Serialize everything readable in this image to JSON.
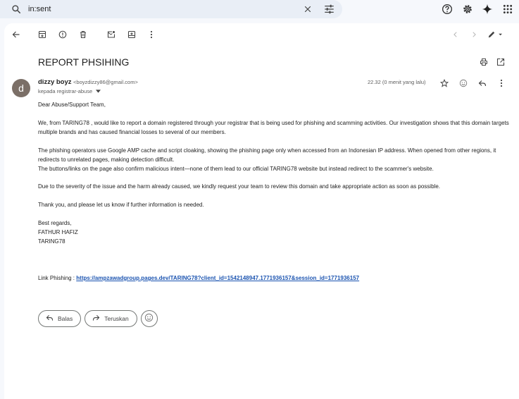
{
  "search": {
    "query": "in:sent"
  },
  "email": {
    "subject": "REPORT PHSIHING",
    "sender_initial": "d",
    "sender_name": "dizzy boyz",
    "sender_email": "<boyzdizzy86@gmail.com>",
    "recipient": "kepada registrar-abuse",
    "timestamp": "22.32 (0 menit yang lalu)",
    "greeting": "Dear Abuse/Support Team,",
    "para1": "We, from TARING78 , would like to report a domain registered through your registrar that is being used for phishing and scamming activities. Our investigation shows that this domain targets multiple brands and has caused financial losses to several of our members.",
    "para2a": "The phishing operators use Google AMP cache and script cloaking, showing the phishing page only when accessed from an Indonesian IP address. When opened from other regions, it redirects to unrelated pages, making detection difficult.",
    "para2b": "The buttons/links on the page also confirm malicious intent—none of them lead to our official TARING78  website but instead redirect to the scammer's website.",
    "para3": "Due to the severity of the issue and the harm already caused, we kindly request your team to review this domain and take appropriate action as soon as possible.",
    "para4": "Thank you, and please let us know if further information is needed.",
    "signoff": "Best regards,",
    "sig_name": "FATHUR HAFIZ",
    "sig_org": "TARING78",
    "link_label": "Link Phishing : ",
    "link_url": "https://ampzawadgroup.pages.dev/TARING78?client_id=1542148947.1771936157&session_id=1771936157"
  },
  "actions": {
    "reply_label": "Balas",
    "forward_label": "Teruskan"
  },
  "colors": {
    "background": "#f6f8fc",
    "search_bg": "#e9eef6",
    "avatar": "#7b6f67",
    "link": "#1a53b0"
  }
}
